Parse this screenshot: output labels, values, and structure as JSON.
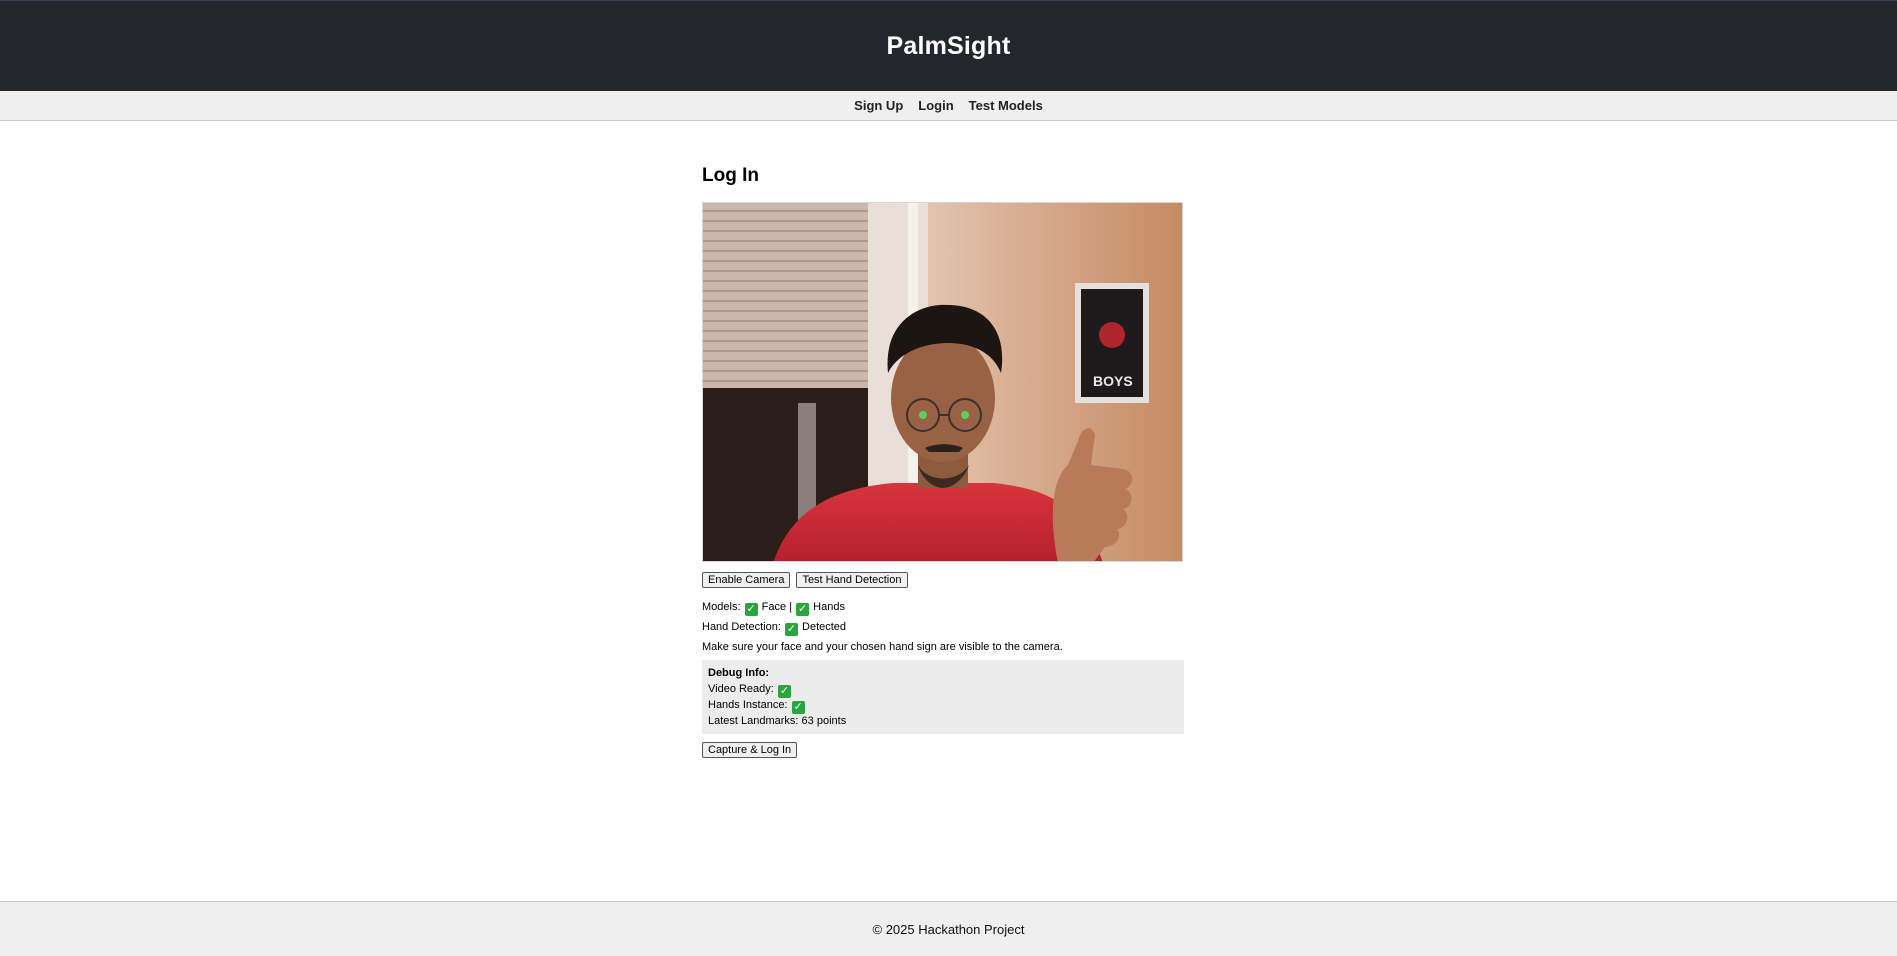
{
  "app": {
    "title": "PalmSight"
  },
  "nav": {
    "signup": "Sign Up",
    "login": "Login",
    "test_models": "Test Models"
  },
  "main": {
    "heading": "Log In",
    "camera_icon": "webcam-feed-image",
    "buttons": {
      "enable_camera": "Enable Camera",
      "test_hand_detection": "Test Hand Detection",
      "capture_login": "Capture & Log In"
    },
    "status": {
      "models_label": "Models:",
      "face_label": "Face",
      "separator": "|",
      "hands_label": "Hands",
      "hand_detection_label": "Hand Detection:",
      "detected_label": "Detected",
      "instruction": "Make sure your face and your chosen hand sign are visible to the camera."
    },
    "check_glyph": "✓",
    "debug": {
      "title": "Debug Info:",
      "video_ready_label": "Video Ready:",
      "hands_instance_label": "Hands Instance:",
      "latest_landmarks": "Latest Landmarks: 63 points"
    }
  },
  "footer": {
    "text": "© 2025 Hackathon Project"
  },
  "colors": {
    "header_bg": "#23262d",
    "nav_bg": "#efefef",
    "check_green": "#2aa43c",
    "debug_bg": "#ececec"
  }
}
